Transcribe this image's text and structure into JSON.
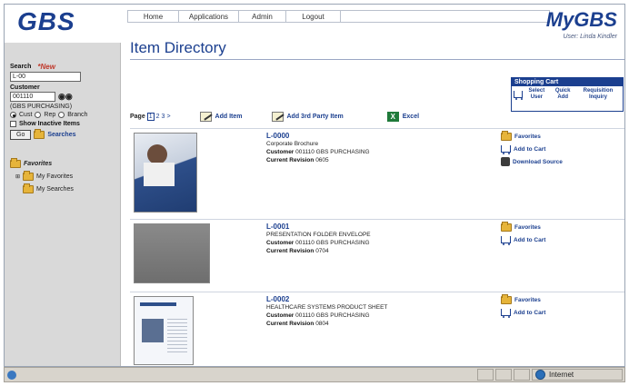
{
  "header": {
    "logo": "GBS",
    "brand": "MyGBS",
    "user": "User: Linda Kindler",
    "nav": [
      "Home",
      "Applications",
      "Admin",
      "Logout"
    ]
  },
  "sidebar": {
    "search_label": "Search",
    "new_label": "*New",
    "search_value": "L-00",
    "customer_label": "Customer",
    "customer_value": "001110",
    "customer_name": "(GBS PURCHASING)",
    "radio_options": [
      "Cust",
      "Rep",
      "Branch"
    ],
    "show_inactive": "Show Inactive Items",
    "go_button": "Go",
    "searches_label": "Searches",
    "tree": {
      "root": "Favorites",
      "children": [
        "My Favorites",
        "My Searches"
      ]
    }
  },
  "main": {
    "title": "Item Directory",
    "page_label": "Page",
    "pages": [
      "1",
      "2",
      "3",
      ">"
    ],
    "toolbar": {
      "add_item": "Add Item",
      "add_third_party": "Add 3rd Party Item",
      "excel": "Excel"
    },
    "cart": {
      "title": "Shopping Cart",
      "buttons": [
        "Select User",
        "Quick Add",
        "Requisition Inquiry"
      ]
    },
    "items": [
      {
        "code": "L-0000",
        "description": "Corporate Brochure",
        "customer_label": "Customer",
        "customer": "001110 GBS PURCHASING",
        "revision_label": "Current Revision",
        "revision": "0605",
        "actions": [
          "Favorites",
          "Add to Cart",
          "Download Source"
        ]
      },
      {
        "code": "L-0001",
        "description": "PRESENTATION FOLDER ENVELOPE",
        "customer_label": "Customer",
        "customer": "001110 GBS PURCHASING",
        "revision_label": "Current Revision",
        "revision": "0704",
        "actions": [
          "Favorites",
          "Add to Cart"
        ]
      },
      {
        "code": "L-0002",
        "description": "HEALTHCARE SYSTEMS PRODUCT SHEET",
        "customer_label": "Customer",
        "customer": "001110 GBS PURCHASING",
        "revision_label": "Current Revision",
        "revision": "0804",
        "actions": [
          "Favorites",
          "Add to Cart"
        ]
      }
    ]
  },
  "statusbar": {
    "zone": "Internet"
  },
  "colors": {
    "brand_blue": "#1b3f8f",
    "sidebar_gray": "#d9d9d9",
    "new_red": "#c0392b"
  }
}
